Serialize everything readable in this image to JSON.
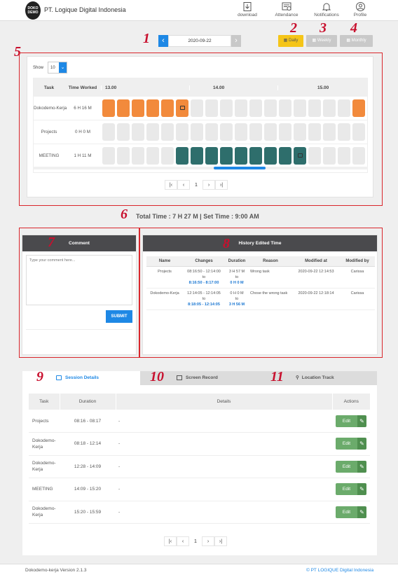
{
  "header": {
    "logo_text": "DOKO DEMO",
    "company": "PT. Logique Digital Indonesia",
    "nav": [
      {
        "label": "download",
        "icon": "download-icon"
      },
      {
        "label": "Attendance",
        "icon": "attendance-icon"
      },
      {
        "label": "Notifications",
        "icon": "bell-icon"
      },
      {
        "label": "Profile",
        "icon": "profile-icon"
      }
    ]
  },
  "date_bar": {
    "date": "2020-09-22",
    "prev": "‹",
    "next": "›"
  },
  "range_buttons": {
    "daily": "Daily",
    "weekly": "Weekly",
    "monthly": "Monthly"
  },
  "annotations": [
    "1",
    "2",
    "3",
    "4",
    "5",
    "6",
    "7",
    "8",
    "9",
    "10",
    "11"
  ],
  "timeline": {
    "show_label": "Show",
    "show_value": "10",
    "headers": {
      "task": "Task",
      "worked": "Time Worked",
      "hours": [
        "13.00",
        "14.00",
        "15.00"
      ]
    },
    "rows": [
      {
        "task": "Dokodemo-Kerja",
        "worked": "6 H 16 M",
        "cells": [
          "o",
          "o",
          "o",
          "o",
          "o",
          "oi",
          "g",
          "g",
          "g",
          "g",
          "g",
          "g",
          "g",
          "g",
          "g",
          "g",
          "g",
          "o",
          "o",
          "o",
          "o",
          "o",
          "oi",
          "g",
          "g",
          "g"
        ]
      },
      {
        "task": "Projects",
        "worked": "0 H 0 M",
        "cells": [
          "g",
          "g",
          "g",
          "g",
          "g",
          "g",
          "g",
          "g",
          "g",
          "g",
          "g",
          "g",
          "g",
          "g",
          "g",
          "g",
          "g",
          "g",
          "g",
          "g",
          "g",
          "g",
          "g",
          "g",
          "g",
          "g"
        ]
      },
      {
        "task": "MEETING",
        "worked": "1 H 11 M",
        "cells": [
          "g",
          "g",
          "g",
          "g",
          "g",
          "t",
          "t",
          "t",
          "t",
          "t",
          "t",
          "t",
          "t",
          "ti",
          "g",
          "g",
          "g",
          "g",
          "g",
          "g",
          "g",
          "g",
          "g",
          "g",
          "g",
          "g"
        ]
      }
    ],
    "pager": {
      "first": "|‹",
      "prev": "‹",
      "page": "1",
      "next": "›",
      "last": "›|"
    }
  },
  "total_time": "Total Time : 7 H 27 M | Set Time : 9:00 AM",
  "comment": {
    "title": "Comment",
    "placeholder": "Type your comment here...",
    "submit": "SUBMIT"
  },
  "history": {
    "title": "History Edited Time",
    "headers": [
      "Name",
      "Changes",
      "Duration",
      "Reason",
      "Modified at",
      "Modified by"
    ],
    "rows": [
      {
        "name": "Projects",
        "from": "08:16:50 - 12:14:00",
        "to_word": "to",
        "to": "8:16:50 - 8:17:00",
        "dur_from": "3 H 57 M",
        "dur_to": "0 H 0 M",
        "reason": "Wrong task",
        "at": "2020-09-22 12:14:53",
        "by": "Carissa"
      },
      {
        "name": "Dokodemo-Kerja",
        "from": "12:14:05 - 12:14:05",
        "to_word": "to",
        "to": "8:18:05 - 12:14:05",
        "dur_from": "0 H 0 M",
        "dur_to": "3 H 56 M",
        "reason": "Chose the wrong task",
        "at": "2020-09-22 12:18:14",
        "by": "Carissa"
      }
    ]
  },
  "tabs": {
    "session": "Session Details",
    "screen": "Screen Record",
    "location": "Location Track"
  },
  "sessions": {
    "headers": [
      "Task",
      "Duration",
      "Details",
      "Actions"
    ],
    "rows": [
      {
        "task": "Projects",
        "duration": "08:16 - 08:17",
        "details": "-"
      },
      {
        "task": "Dokodemo-Kerja",
        "duration": "08:18 - 12:14",
        "details": "-"
      },
      {
        "task": "Dokodemo-Kerja",
        "duration": "12:28 - 14:09",
        "details": "-"
      },
      {
        "task": "MEETING",
        "duration": "14:09 - 15:20",
        "details": "-"
      },
      {
        "task": "Dokodemo-Kerja",
        "duration": "15:20 - 15:59",
        "details": "-"
      }
    ],
    "edit": "Edit"
  },
  "footer": {
    "version": "Dokodemo-kerja Version 2.1.3",
    "copyright": "© PT LOGIQUE Digital Indonesia"
  }
}
